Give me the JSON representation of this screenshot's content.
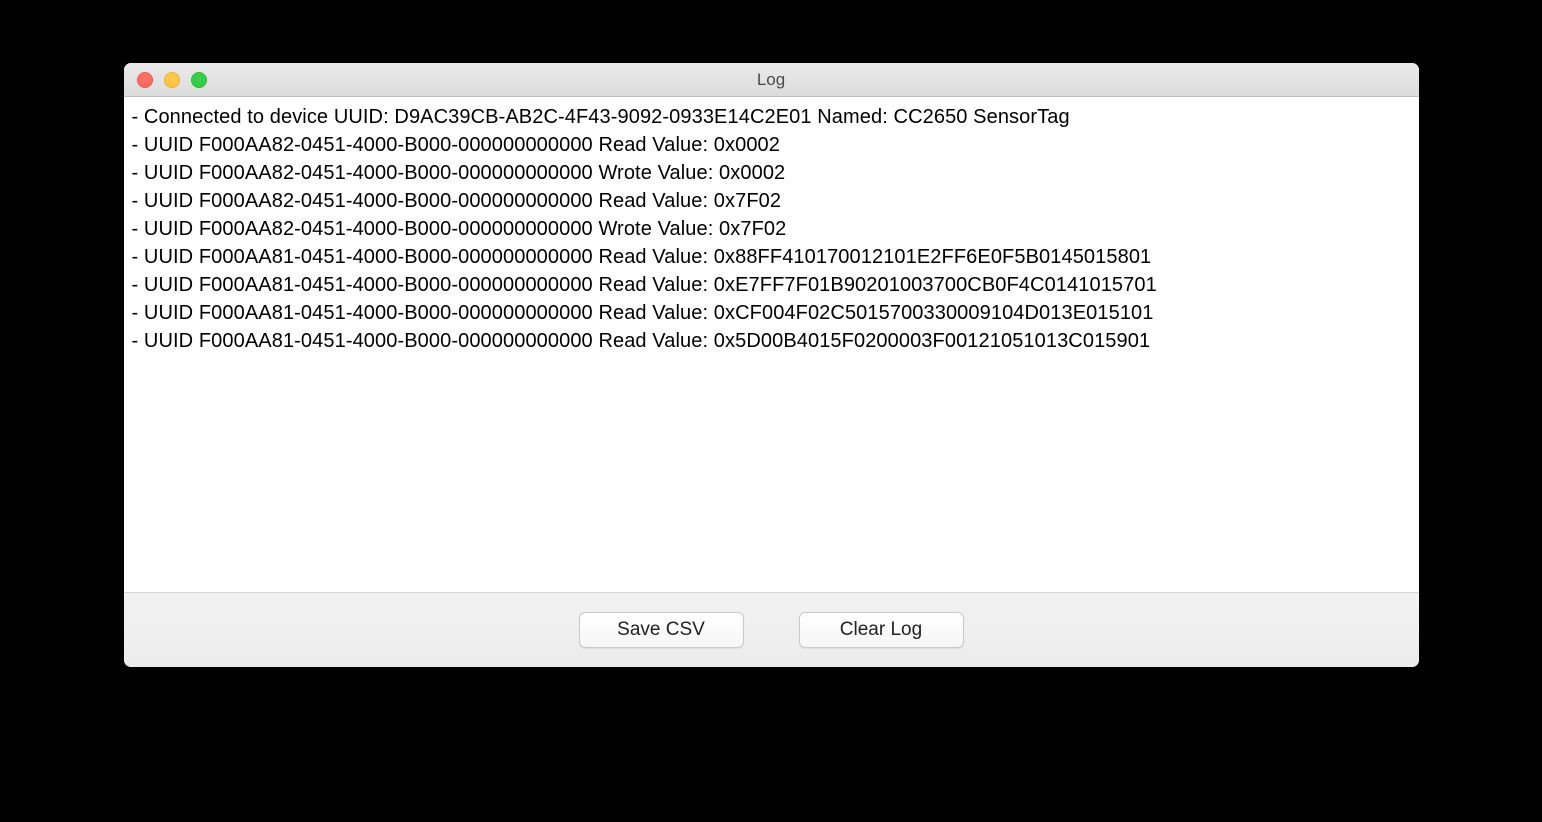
{
  "window": {
    "title": "Log"
  },
  "log": {
    "lines": [
      "- Connected to device UUID: D9AC39CB-AB2C-4F43-9092-0933E14C2E01 Named: CC2650 SensorTag",
      "- UUID F000AA82-0451-4000-B000-000000000000 Read Value: 0x0002",
      "- UUID F000AA82-0451-4000-B000-000000000000 Wrote Value: 0x0002",
      "- UUID F000AA82-0451-4000-B000-000000000000 Read Value: 0x7F02",
      "- UUID F000AA82-0451-4000-B000-000000000000 Wrote Value: 0x7F02",
      "- UUID F000AA81-0451-4000-B000-000000000000 Read Value: 0x88FF410170012101E2FF6E0F5B0145015801",
      "- UUID F000AA81-0451-4000-B000-000000000000 Read Value: 0xE7FF7F01B90201003700CB0F4C0141015701",
      "- UUID F000AA81-0451-4000-B000-000000000000 Read Value: 0xCF004F02C5015700330009104D013E015101",
      "- UUID F000AA81-0451-4000-B000-000000000000 Read Value: 0x5D00B4015F0200003F00121051013C015901"
    ]
  },
  "toolbar": {
    "save_csv_label": "Save CSV",
    "clear_log_label": "Clear Log"
  }
}
